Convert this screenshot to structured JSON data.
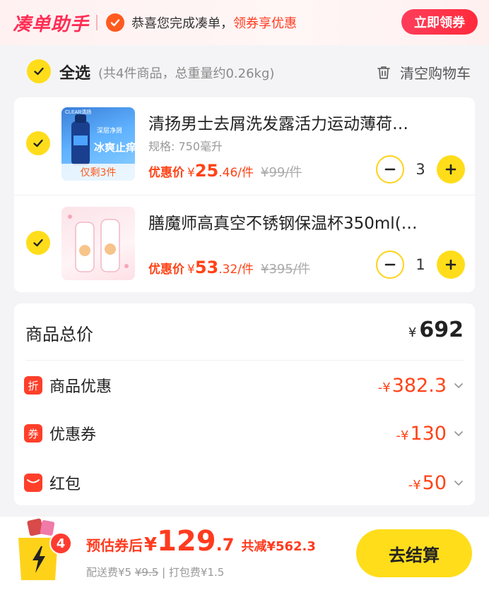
{
  "header": {
    "brand": "凑单助手",
    "message": "恭喜您完成凑单，",
    "message_highlight": "领券享优惠",
    "action_label": "立即领券",
    "accent": "#ff2e55"
  },
  "select_bar": {
    "label": "全选",
    "summary": "(共4件商品，总重量约0.26kg)",
    "clear_label": "清空购物车"
  },
  "items": [
    {
      "title": "清扬男士去屑洗发露活力运动薄荷…",
      "spec": "规格: 750毫升",
      "stock_tag": "仅剩3件",
      "image_text": [
        "CLEAR清扬",
        "深层净屑",
        "冰爽止痒"
      ],
      "price_label": "优惠价",
      "price_yen": "¥",
      "price_main": "25",
      "price_rest": ".46/件",
      "original_price": "¥99/件",
      "quantity": "3",
      "checked": true
    },
    {
      "title": "膳魔师高真空不锈钢保温杯350ml(…",
      "spec": "",
      "price_label": "优惠价",
      "price_yen": "¥",
      "price_main": "53",
      "price_rest": ".32/件",
      "original_price": "¥395/件",
      "quantity": "1",
      "checked": true
    }
  ],
  "summary": {
    "title": "商品总价",
    "total_yen": "¥",
    "total": "692",
    "discounts": [
      {
        "icon_text": "折",
        "label": "商品优惠",
        "sign": "-",
        "yen": "¥",
        "value": "382.3",
        "icon": "discount-icon"
      },
      {
        "icon_text": "券",
        "label": "优惠券",
        "sign": "-",
        "yen": "¥",
        "value": "130",
        "icon": "coupon-icon"
      },
      {
        "icon_text": "",
        "label": "红包",
        "sign": "-",
        "yen": "¥",
        "value": "50",
        "icon": "red-envelope-icon"
      }
    ]
  },
  "footer": {
    "cart_count": "4",
    "estimate_label": "预估券后",
    "estimate_yen": "¥",
    "estimate_main": "129",
    "estimate_decimal": ".7",
    "savings": "共减¥562.3",
    "shipping_label": "配送费¥5",
    "shipping_original": "¥9.5",
    "separator": "|",
    "packing_fee": "打包费¥1.5",
    "checkout_label": "去结算"
  }
}
